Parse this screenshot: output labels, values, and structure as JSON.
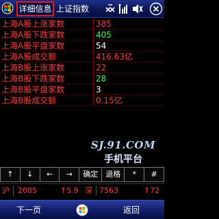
{
  "titlebar": {
    "active_tab": "详细信息",
    "inactive_tab": "上证指数",
    "tray": {
      "icons": [
        "connection-icon",
        "signal-icon",
        "volume-muted-icon",
        "close-icon"
      ],
      "close_label": "✕"
    }
  },
  "table": {
    "rows": [
      {
        "label": "上海A股上涨家数",
        "value": "385",
        "color": "#ff3b3b"
      },
      {
        "label": "上海A股下跌家数",
        "value": "405",
        "color": "#38ff38"
      },
      {
        "label": "上海A股平盘家数",
        "value": "54",
        "color": "#ffffff"
      },
      {
        "label": "上海A股成交额",
        "value": "416.63亿",
        "color": "#ff3b3b"
      },
      {
        "label": "上海B股上涨家数",
        "value": "22",
        "color": "#ff3b3b"
      },
      {
        "label": "上海B股下跌家数",
        "value": "28",
        "color": "#38ff38"
      },
      {
        "label": "上海B股平盘家数",
        "value": "3",
        "color": "#ffffff"
      },
      {
        "label": "上海B股成交额",
        "value": "0.15亿",
        "color": "#ff3b3b"
      }
    ]
  },
  "watermark": {
    "line1": "SJ.91.COM",
    "line2": "手机平台"
  },
  "keys": [
    "↑",
    "↓",
    "←",
    "→",
    "确定",
    "退格",
    "*",
    "#"
  ],
  "quote": {
    "sh_label": "沪",
    "sh_value": "2085",
    "sh_change": "↑5.9",
    "sz_label": "深",
    "sz_value": "7563",
    "sz_change": "↑72"
  },
  "softkeys": {
    "left": "下一页",
    "right": "返回"
  }
}
